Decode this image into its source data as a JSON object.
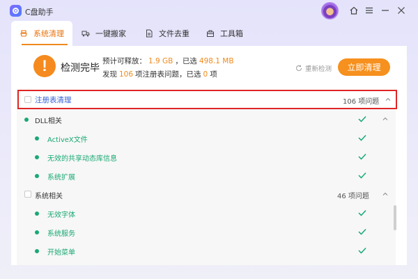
{
  "app": {
    "title": "C盘助手"
  },
  "tabs": [
    {
      "label": "系统清理",
      "icon": "broom-icon"
    },
    {
      "label": "一键搬家",
      "icon": "truck-icon"
    },
    {
      "label": "文件去重",
      "icon": "file-icon"
    },
    {
      "label": "工具箱",
      "icon": "toolbox-icon"
    }
  ],
  "summary": {
    "title": "检测完毕",
    "line1_prefix": "预计可释放：",
    "line1_value": "1.9 GB",
    "line1_sep": "，已选",
    "line1_selected": "498.1 MB",
    "line2_prefix": "发现",
    "line2_count": "106",
    "line2_mid": "项注册表问题，已选",
    "line2_selected": "0",
    "line2_suffix": "项",
    "rescan_label": "重新检测",
    "clean_button": "立即清理"
  },
  "registry": {
    "title": "注册表清理",
    "count": "106 项问题",
    "groups": [
      {
        "label": "DLL相关",
        "items": [
          "ActiveX文件",
          "无效的共享动态库信息",
          "系统扩展"
        ]
      },
      {
        "label": "系统相关",
        "count": "46 项问题",
        "items": [
          "无效字体",
          "系统服务",
          "开始菜单"
        ]
      }
    ]
  },
  "colors": {
    "accent": "#f6901e",
    "success": "#19a974",
    "link": "#3a63d6",
    "alert": "#e02525"
  }
}
